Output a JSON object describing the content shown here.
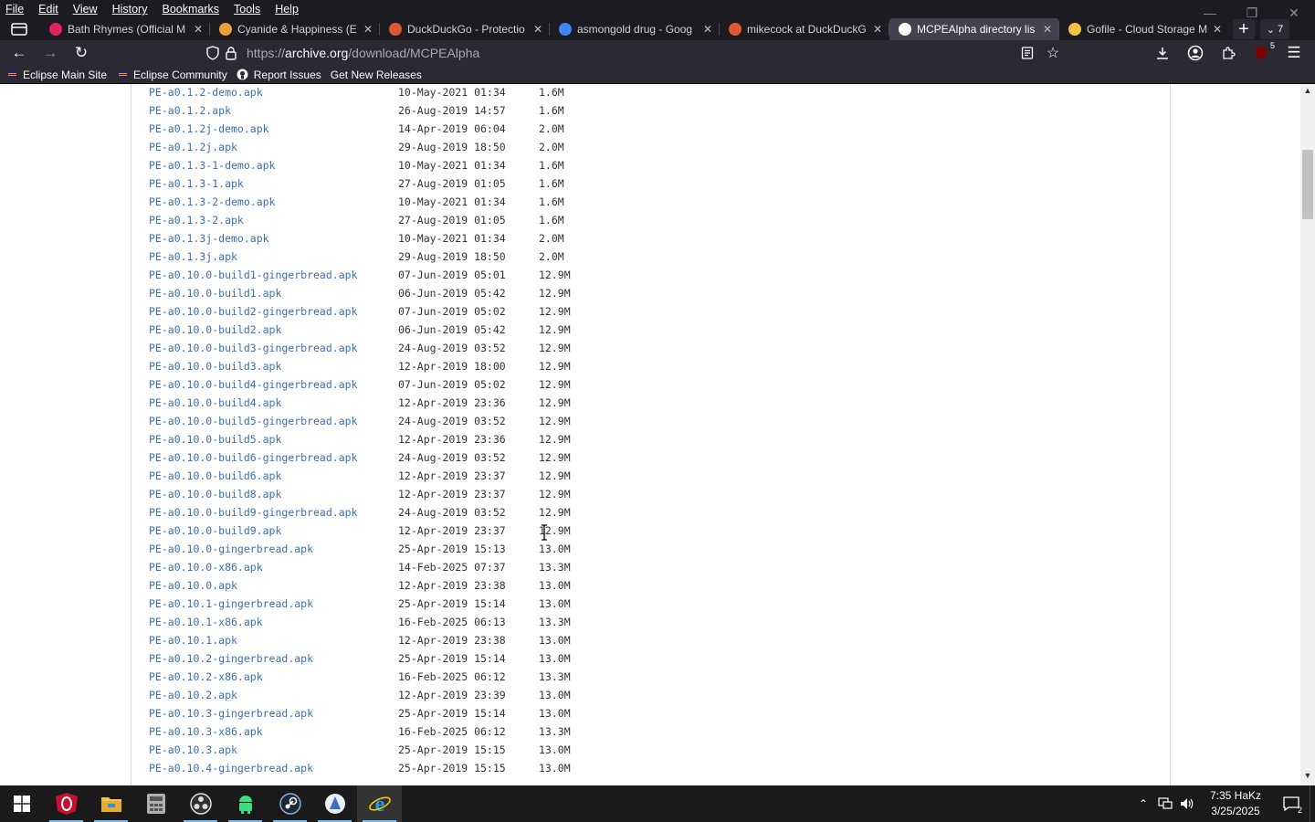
{
  "menu": [
    "File",
    "Edit",
    "View",
    "History",
    "Bookmarks",
    "Tools",
    "Help"
  ],
  "tabs": [
    {
      "title": "Bath Rhymes (Official M",
      "color": "#e0245e",
      "active": false
    },
    {
      "title": "Cyanide & Happiness (E",
      "color": "#e8a23a",
      "active": false
    },
    {
      "title": "DuckDuckGo - Protectio",
      "color": "#de5833",
      "active": false
    },
    {
      "title": "asmongold drug - Goog",
      "color": "#4285f4",
      "active": false
    },
    {
      "title": "mikecock at DuckDuckG",
      "color": "#de5833",
      "active": false
    },
    {
      "title": "MCPEAlpha directory lis",
      "color": "#ffffff",
      "active": true
    },
    {
      "title": "Gofile - Cloud Storage M",
      "color": "#f5c242",
      "active": false
    }
  ],
  "tab_count": "7",
  "url": {
    "prefix": "https://",
    "host": "archive.org",
    "path": "/download/MCPEAlpha"
  },
  "ublock_count": "5",
  "bookmarks": [
    "Eclipse Main Site",
    "Eclipse Community",
    "Report Issues",
    "Get New Releases"
  ],
  "files": [
    {
      "name": "PE-a0.1.2-demo.apk",
      "date": "10-May-2021 01:34",
      "size": "1.6M"
    },
    {
      "name": "PE-a0.1.2.apk",
      "date": "26-Aug-2019 14:57",
      "size": "1.6M"
    },
    {
      "name": "PE-a0.1.2j-demo.apk",
      "date": "14-Apr-2019 06:04",
      "size": "2.0M"
    },
    {
      "name": "PE-a0.1.2j.apk",
      "date": "29-Aug-2019 18:50",
      "size": "2.0M"
    },
    {
      "name": "PE-a0.1.3-1-demo.apk",
      "date": "10-May-2021 01:34",
      "size": "1.6M"
    },
    {
      "name": "PE-a0.1.3-1.apk",
      "date": "27-Aug-2019 01:05",
      "size": "1.6M"
    },
    {
      "name": "PE-a0.1.3-2-demo.apk",
      "date": "10-May-2021 01:34",
      "size": "1.6M"
    },
    {
      "name": "PE-a0.1.3-2.apk",
      "date": "27-Aug-2019 01:05",
      "size": "1.6M"
    },
    {
      "name": "PE-a0.1.3j-demo.apk",
      "date": "10-May-2021 01:34",
      "size": "2.0M"
    },
    {
      "name": "PE-a0.1.3j.apk",
      "date": "29-Aug-2019 18:50",
      "size": "2.0M"
    },
    {
      "name": "PE-a0.10.0-build1-gingerbread.apk",
      "date": "07-Jun-2019 05:01",
      "size": "12.9M"
    },
    {
      "name": "PE-a0.10.0-build1.apk",
      "date": "06-Jun-2019 05:42",
      "size": "12.9M"
    },
    {
      "name": "PE-a0.10.0-build2-gingerbread.apk",
      "date": "07-Jun-2019 05:02",
      "size": "12.9M"
    },
    {
      "name": "PE-a0.10.0-build2.apk",
      "date": "06-Jun-2019 05:42",
      "size": "12.9M"
    },
    {
      "name": "PE-a0.10.0-build3-gingerbread.apk",
      "date": "24-Aug-2019 03:52",
      "size": "12.9M"
    },
    {
      "name": "PE-a0.10.0-build3.apk",
      "date": "12-Apr-2019 18:00",
      "size": "12.9M"
    },
    {
      "name": "PE-a0.10.0-build4-gingerbread.apk",
      "date": "07-Jun-2019 05:02",
      "size": "12.9M"
    },
    {
      "name": "PE-a0.10.0-build4.apk",
      "date": "12-Apr-2019 23:36",
      "size": "12.9M"
    },
    {
      "name": "PE-a0.10.0-build5-gingerbread.apk",
      "date": "24-Aug-2019 03:52",
      "size": "12.9M"
    },
    {
      "name": "PE-a0.10.0-build5.apk",
      "date": "12-Apr-2019 23:36",
      "size": "12.9M"
    },
    {
      "name": "PE-a0.10.0-build6-gingerbread.apk",
      "date": "24-Aug-2019 03:52",
      "size": "12.9M"
    },
    {
      "name": "PE-a0.10.0-build6.apk",
      "date": "12-Apr-2019 23:37",
      "size": "12.9M"
    },
    {
      "name": "PE-a0.10.0-build8.apk",
      "date": "12-Apr-2019 23:37",
      "size": "12.9M"
    },
    {
      "name": "PE-a0.10.0-build9-gingerbread.apk",
      "date": "24-Aug-2019 03:52",
      "size": "12.9M"
    },
    {
      "name": "PE-a0.10.0-build9.apk",
      "date": "12-Apr-2019 23:37",
      "size": "12.9M"
    },
    {
      "name": "PE-a0.10.0-gingerbread.apk",
      "date": "25-Apr-2019 15:13",
      "size": "13.0M"
    },
    {
      "name": "PE-a0.10.0-x86.apk",
      "date": "14-Feb-2025 07:37",
      "size": "13.3M"
    },
    {
      "name": "PE-a0.10.0.apk",
      "date": "12-Apr-2019 23:38",
      "size": "13.0M"
    },
    {
      "name": "PE-a0.10.1-gingerbread.apk",
      "date": "25-Apr-2019 15:14",
      "size": "13.0M"
    },
    {
      "name": "PE-a0.10.1-x86.apk",
      "date": "16-Feb-2025 06:13",
      "size": "13.3M"
    },
    {
      "name": "PE-a0.10.1.apk",
      "date": "12-Apr-2019 23:38",
      "size": "13.0M"
    },
    {
      "name": "PE-a0.10.2-gingerbread.apk",
      "date": "25-Apr-2019 15:14",
      "size": "13.0M"
    },
    {
      "name": "PE-a0.10.2-x86.apk",
      "date": "16-Feb-2025 06:12",
      "size": "13.3M"
    },
    {
      "name": "PE-a0.10.2.apk",
      "date": "12-Apr-2019 23:39",
      "size": "13.0M"
    },
    {
      "name": "PE-a0.10.3-gingerbread.apk",
      "date": "25-Apr-2019 15:14",
      "size": "13.0M"
    },
    {
      "name": "PE-a0.10.3-x86.apk",
      "date": "16-Feb-2025 06:12",
      "size": "13.3M"
    },
    {
      "name": "PE-a0.10.3.apk",
      "date": "25-Apr-2019 15:15",
      "size": "13.0M"
    },
    {
      "name": "PE-a0.10.4-gingerbread.apk",
      "date": "25-Apr-2019 15:15",
      "size": "13.0M"
    }
  ],
  "taskbar": {
    "apps": [
      "opera-gx",
      "file-explorer",
      "calculator",
      "obs-studio",
      "android-studio",
      "steam",
      "app-launcher",
      "internet-explorer"
    ],
    "clock_time": "7:35 HaKz",
    "clock_date": "3/25/2025",
    "notification_count": "2"
  },
  "colors": {
    "link": "#3a70b0",
    "chrome_dark": "#1c1b22",
    "toolbar": "#2b2a33",
    "active_tab": "#42414d"
  }
}
